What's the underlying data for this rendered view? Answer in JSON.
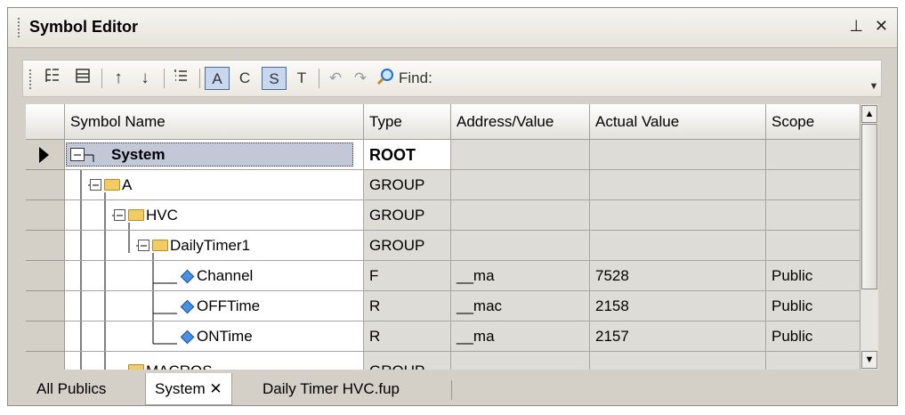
{
  "window": {
    "title": "Symbol Editor",
    "pin_glyph": "⊥",
    "close_glyph": "✕"
  },
  "toolbar": {
    "btn_a": "A",
    "btn_c": "C",
    "btn_s": "S",
    "btn_t": "T",
    "find_label": "Find:",
    "undo_glyph": "↶",
    "redo_glyph": "↷",
    "up_glyph": "↑",
    "down_glyph": "↓"
  },
  "table": {
    "columns": [
      "Symbol Name",
      "Type",
      "Address/Value",
      "Actual Value",
      "Scope"
    ],
    "rows": [
      {
        "name": "System",
        "type": "ROOT",
        "address": "",
        "actual": "",
        "scope": "",
        "kind": "root"
      },
      {
        "name": "A",
        "type": "GROUP",
        "address": "",
        "actual": "",
        "scope": "",
        "kind": "folder"
      },
      {
        "name": "HVC",
        "type": "GROUP",
        "address": "",
        "actual": "",
        "scope": "",
        "kind": "folder"
      },
      {
        "name": "DailyTimer1",
        "type": "GROUP",
        "address": "",
        "actual": "",
        "scope": "",
        "kind": "folder"
      },
      {
        "name": "Channel",
        "type": "F",
        "address": "__ma",
        "actual": "7528",
        "scope": "Public",
        "kind": "symbol"
      },
      {
        "name": "OFFTime",
        "type": "R",
        "address": "__mac",
        "actual": "2158",
        "scope": "Public",
        "kind": "symbol"
      },
      {
        "name": "ONTime",
        "type": "R",
        "address": "__ma",
        "actual": "2157",
        "scope": "Public",
        "kind": "symbol"
      },
      {
        "name": "MACROS",
        "type": "GROUP",
        "address": "",
        "actual": "",
        "scope": "",
        "kind": "folder"
      }
    ]
  },
  "tabs": [
    {
      "label": "All Publics"
    },
    {
      "label": "System ✕"
    },
    {
      "label": "Daily Timer HVC.fup"
    }
  ],
  "colors": {
    "selection": "#c2c8d8",
    "folder": "#f1cc63",
    "symbol_icon": "#4a90e2"
  }
}
